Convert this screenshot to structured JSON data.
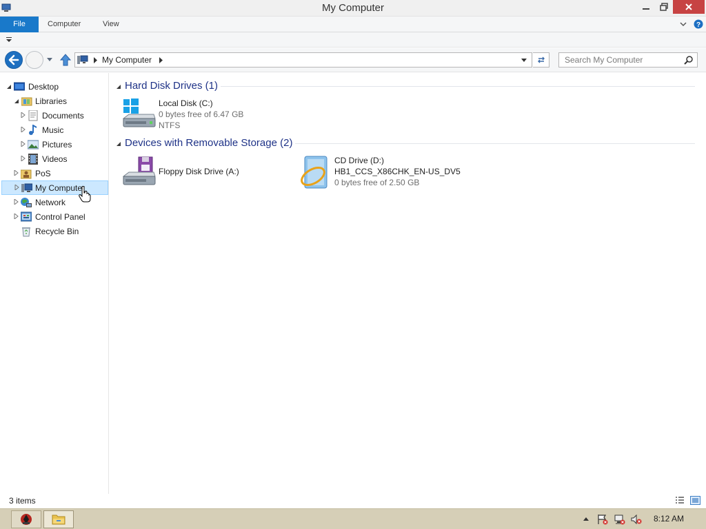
{
  "window": {
    "title": "My Computer"
  },
  "ribbon": {
    "tabs": [
      {
        "label": "File"
      },
      {
        "label": "Computer"
      },
      {
        "label": "View"
      }
    ]
  },
  "navigation": {
    "breadcrumb": "My Computer",
    "search_placeholder": "Search My Computer"
  },
  "tree": [
    {
      "label": "Desktop",
      "icon": "desktop-icon"
    },
    {
      "label": "Libraries",
      "icon": "libraries-icon"
    },
    {
      "label": "Documents",
      "icon": "documents-icon"
    },
    {
      "label": "Music",
      "icon": "music-icon"
    },
    {
      "label": "Pictures",
      "icon": "pictures-icon"
    },
    {
      "label": "Videos",
      "icon": "videos-icon"
    },
    {
      "label": "PoS",
      "icon": "user-folder-icon"
    },
    {
      "label": "My Computer",
      "icon": "computer-icon",
      "selected": true
    },
    {
      "label": "Network",
      "icon": "network-icon"
    },
    {
      "label": "Control Panel",
      "icon": "control-panel-icon"
    },
    {
      "label": "Recycle Bin",
      "icon": "recycle-bin-icon"
    }
  ],
  "groups": [
    {
      "header": "Hard Disk Drives (1)",
      "items": [
        {
          "name": "Local Disk (C:)",
          "line2": "0 bytes free of 6.47 GB",
          "line3": "NTFS",
          "icon": "local-disk-icon"
        }
      ]
    },
    {
      "header": "Devices with Removable Storage (2)",
      "items": [
        {
          "name": "Floppy Disk Drive (A:)",
          "icon": "floppy-drive-icon"
        },
        {
          "name": "CD Drive (D:)",
          "line2": "HB1_CCS_X86CHK_EN-US_DV5",
          "line3": "0 bytes free of 2.50 GB",
          "icon": "cd-drive-icon"
        }
      ]
    }
  ],
  "status": {
    "items_count": "3 items"
  },
  "taskbar": {
    "clock": "8:12 AM"
  },
  "colors": {
    "accent": "#1979ca",
    "group_header": "#1e3287",
    "selection": "#cce8ff",
    "taskbar": "#d6cfb7"
  }
}
